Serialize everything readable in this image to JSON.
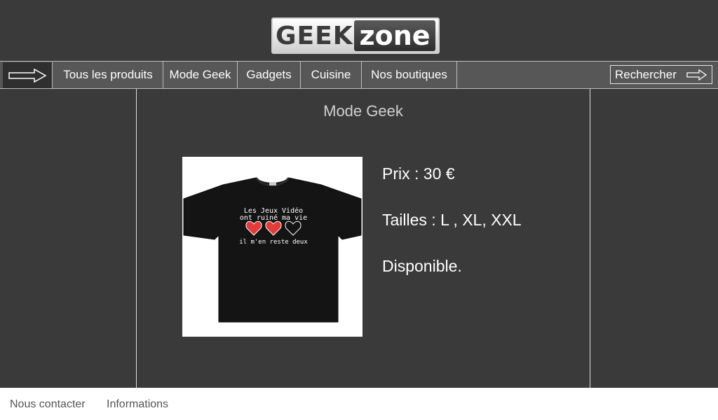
{
  "header": {
    "logo_left": "GEEK",
    "logo_right": "zone"
  },
  "nav": {
    "back_icon": "arrow-right-icon",
    "items": [
      {
        "label": "Tous les produits"
      },
      {
        "label": "Mode Geek"
      },
      {
        "label": "Gadgets"
      },
      {
        "label": "Cuisine"
      },
      {
        "label": "Nos boutiques"
      }
    ],
    "search_label": "Rechercher",
    "search_icon": "arrow-right-icon"
  },
  "main": {
    "title": "Mode Geek",
    "product": {
      "image_text": [
        "Les Jeux Vidéo",
        "ont ruiné ma vie",
        "il m'en reste deux"
      ],
      "hearts": {
        "filled": 2,
        "total": 3
      },
      "price": "Prix : 30 €",
      "sizes": "Tailles : L , XL, XXL",
      "availability": "Disponible."
    }
  },
  "footer": {
    "links": [
      "Nous contacter",
      "Informations"
    ]
  },
  "colors": {
    "background": "#3a3a3a",
    "nav": "#575757",
    "heart": "#e23b3b"
  }
}
